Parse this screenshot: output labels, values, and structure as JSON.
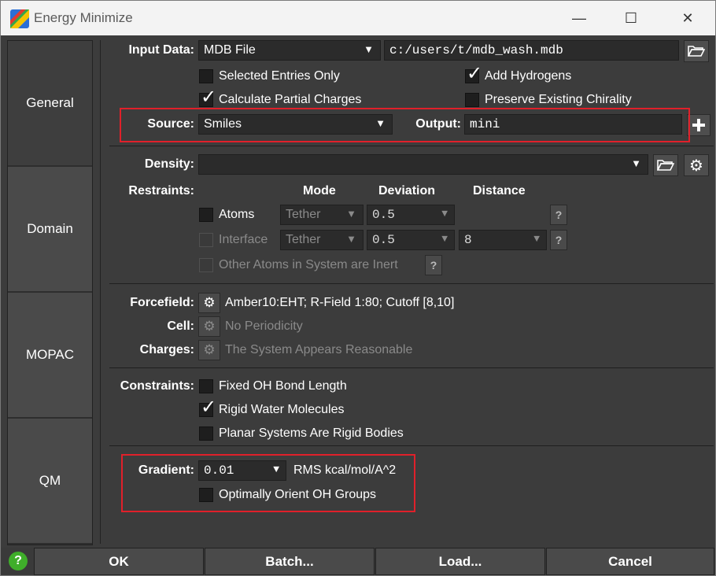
{
  "window": {
    "title": "Energy Minimize"
  },
  "title_controls": {
    "minimize": "—",
    "maximize": "☐",
    "close": "✕"
  },
  "sidebar": {
    "tabs": [
      "General",
      "Domain",
      "MOPAC",
      "QM"
    ],
    "active": "General"
  },
  "input": {
    "label": "Input Data:",
    "type_value": "MDB File",
    "path_value": "c:/users/t/mdb_wash.mdb",
    "selected_entries_only": {
      "label": "Selected Entries Only",
      "checked": false
    },
    "add_hydrogens": {
      "label": "Add Hydrogens",
      "checked": true
    },
    "calculate_partial_charges": {
      "label": "Calculate Partial Charges",
      "checked": true
    },
    "preserve_chirality": {
      "label": "Preserve Existing Chirality",
      "checked": false
    }
  },
  "source": {
    "label": "Source:",
    "value": "Smiles"
  },
  "output": {
    "label": "Output:",
    "value": "mini",
    "add_icon": "plus-icon"
  },
  "density": {
    "label": "Density:",
    "value": ""
  },
  "restraints": {
    "label": "Restraints:",
    "headers": {
      "mode": "Mode",
      "deviation": "Deviation",
      "distance": "Distance"
    },
    "atoms": {
      "label": "Atoms",
      "mode": "Tether",
      "deviation": "0.5",
      "checked": false
    },
    "interface": {
      "label": "Interface",
      "mode": "Tether",
      "deviation": "0.5",
      "distance": "8",
      "checked": false
    },
    "inert": {
      "label": "Other Atoms in System are Inert",
      "checked": false
    },
    "help": "?"
  },
  "forcefield": {
    "label": "Forcefield:",
    "value": "Amber10:EHT;  R-Field 1:80;  Cutoff [8,10]"
  },
  "cell": {
    "label": "Cell:",
    "value": "No Periodicity"
  },
  "charges": {
    "label": "Charges:",
    "value": "The System Appears Reasonable"
  },
  "constraints": {
    "label": "Constraints:",
    "fixed_oh": {
      "label": "Fixed OH Bond Length",
      "checked": false
    },
    "rigid_water": {
      "label": "Rigid Water Molecules",
      "checked": true
    },
    "planar": {
      "label": "Planar Systems Are Rigid Bodies",
      "checked": false
    }
  },
  "gradient": {
    "label": "Gradient:",
    "value": "0.01",
    "unit": "RMS kcal/mol/A^2"
  },
  "orient_oh": {
    "label": "Optimally Orient OH Groups",
    "checked": false
  },
  "buttons": {
    "help": "?",
    "ok": "OK",
    "batch": "Batch...",
    "load": "Load...",
    "cancel": "Cancel"
  },
  "colors": {
    "highlight": "#e0202a",
    "background": "#3c3c3c",
    "help_green": "#3fae2a"
  }
}
